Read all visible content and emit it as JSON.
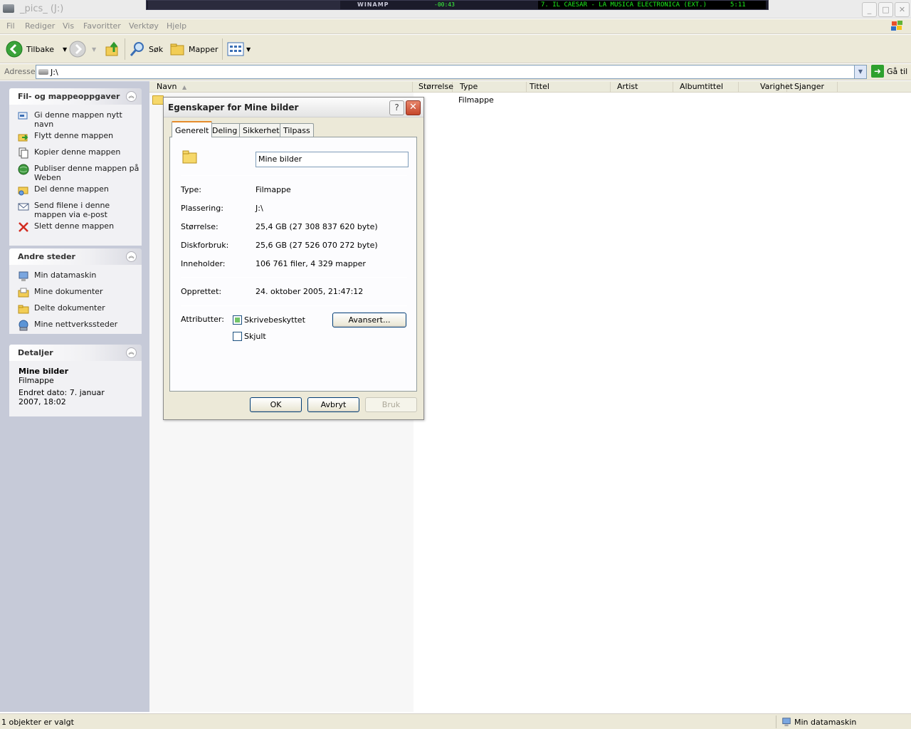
{
  "window": {
    "title": "_pics_ (J:)",
    "controls": {
      "minimize": "_",
      "maximize": "□",
      "close": "✕"
    }
  },
  "winamp": {
    "logo": "WINAMP",
    "time": "-00:43",
    "track": "7. IL CAESAR - LA MUSICA ELECTRONICA (EXT.)",
    "duration": "5:11"
  },
  "menu": [
    "Fil",
    "Rediger",
    "Vis",
    "Favoritter",
    "Verktøy",
    "Hjelp"
  ],
  "toolbar": {
    "back_label": "Tilbake",
    "search_label": "Søk",
    "folders_label": "Mapper"
  },
  "address": {
    "label": "Adresse",
    "value": "J:\\",
    "go_label": "Gå til"
  },
  "left_pane": {
    "tasks": {
      "title": "Fil- og mappeoppgaver",
      "items": [
        "Gi denne mappen nytt navn",
        "Flytt denne mappen",
        "Kopier denne mappen",
        "Publiser denne mappen på Weben",
        "Del denne mappen",
        "Send filene i denne mappen via e-post",
        "Slett denne mappen"
      ]
    },
    "other_places": {
      "title": "Andre steder",
      "items": [
        "Min datamaskin",
        "Mine dokumenter",
        "Delte dokumenter",
        "Mine nettverkssteder"
      ]
    },
    "details": {
      "title": "Detaljer",
      "name": "Mine bilder",
      "type": "Filmappe",
      "modified": "Endret dato: 7. januar 2007, 18:02"
    }
  },
  "columns": [
    "Navn",
    "Størrelse",
    "Type",
    "Tittel",
    "Artist",
    "Albumtittel",
    "Varighet",
    "Sjanger"
  ],
  "row": {
    "type": "Filmappe"
  },
  "status": {
    "left": "1 objekter er valgt",
    "right": "Min datamaskin"
  },
  "dialog": {
    "title": "Egenskaper for Mine bilder",
    "help": "?",
    "close": "✕",
    "tabs": [
      "Generelt",
      "Deling",
      "Sikkerhet",
      "Tilpass"
    ],
    "active_tab": "Generelt",
    "name_value": "Mine bilder",
    "props": [
      {
        "label": "Type:",
        "value": "Filmappe"
      },
      {
        "label": "Plassering:",
        "value": "J:\\"
      },
      {
        "label": "Størrelse:",
        "value": "25,4 GB (27 308 837 620 byte)"
      },
      {
        "label": "Diskforbruk:",
        "value": "25,6 GB (27 526 070 272 byte)"
      },
      {
        "label": "Inneholder:",
        "value": "106 761 filer, 4 329 mapper"
      }
    ],
    "created_label": "Opprettet:",
    "created_value": "24. oktober 2005, 21:47:12",
    "attributes_label": "Attributter:",
    "readonly_label": "Skrivebeskyttet",
    "readonly_state": "mixed",
    "hidden_label": "Skjult",
    "hidden_state": "unchecked",
    "advanced_label": "Avansert...",
    "ok_label": "OK",
    "cancel_label": "Avbryt",
    "apply_label": "Bruk"
  }
}
